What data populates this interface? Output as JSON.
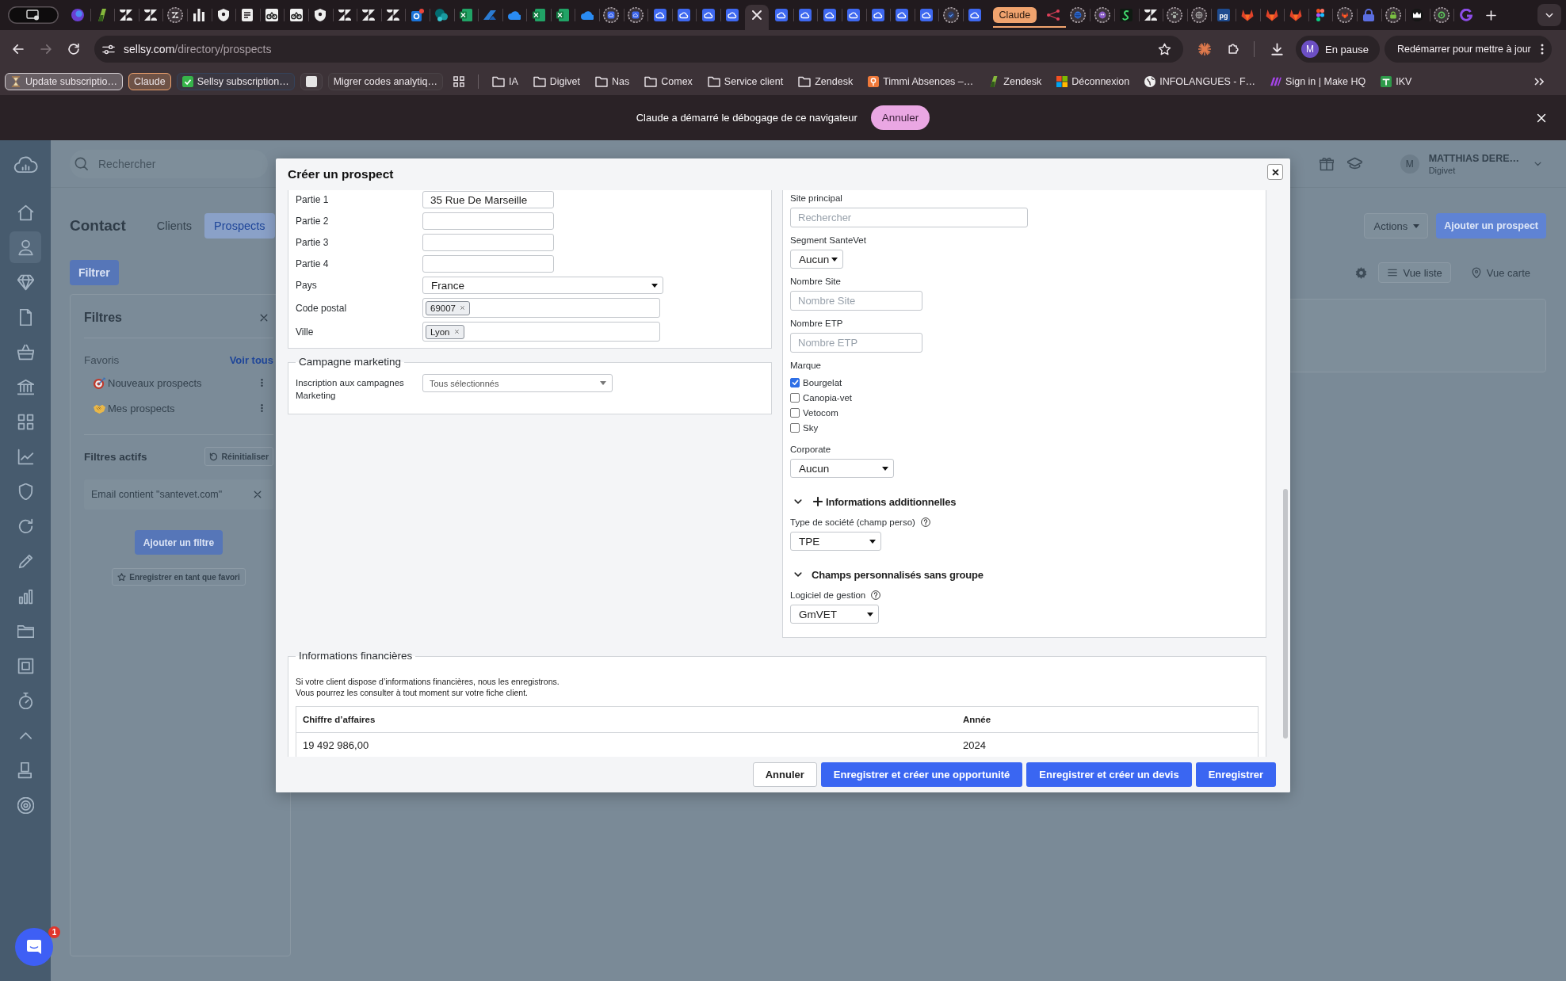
{
  "browser": {
    "tabs": [
      {
        "kind": "screen",
        "selected": false,
        "asleep": false
      },
      {
        "kind": "orb",
        "selected": false,
        "asleep": false
      },
      {
        "kind": "leaf",
        "selected": false,
        "asleep": false
      },
      {
        "kind": "z",
        "selected": false,
        "asleep": false
      },
      {
        "kind": "z",
        "selected": false,
        "asleep": false
      },
      {
        "kind": "z",
        "selected": false,
        "asleep": true
      },
      {
        "kind": "bars",
        "selected": false,
        "asleep": false
      },
      {
        "kind": "shield",
        "selected": false,
        "asleep": false
      },
      {
        "kind": "doc",
        "selected": false,
        "asleep": false
      },
      {
        "kind": "bikes",
        "selected": false,
        "asleep": false
      },
      {
        "kind": "bikes",
        "selected": false,
        "asleep": false
      },
      {
        "kind": "shield",
        "selected": false,
        "asleep": false
      },
      {
        "kind": "z",
        "selected": false,
        "asleep": false
      },
      {
        "kind": "z",
        "selected": false,
        "asleep": false
      },
      {
        "kind": "z",
        "selected": false,
        "asleep": false
      },
      {
        "kind": "mail",
        "selected": false,
        "asleep": false
      },
      {
        "kind": "share",
        "selected": false,
        "asleep": false
      },
      {
        "kind": "sheet",
        "selected": false,
        "asleep": false
      },
      {
        "kind": "arrow",
        "selected": false,
        "asleep": false
      },
      {
        "kind": "cloud",
        "selected": false,
        "asleep": false
      },
      {
        "kind": "sheet",
        "selected": false,
        "asleep": false
      },
      {
        "kind": "sheet",
        "selected": false,
        "asleep": false
      },
      {
        "kind": "cloud",
        "selected": false,
        "asleep": false
      },
      {
        "kind": "cloud-tile",
        "selected": false,
        "asleep": true
      },
      {
        "kind": "cloud-tile",
        "selected": false,
        "asleep": true
      },
      {
        "kind": "cloud-tile",
        "selected": false,
        "asleep": false
      },
      {
        "kind": "cloud-tile",
        "selected": false,
        "asleep": false
      },
      {
        "kind": "cloud-tile",
        "selected": false,
        "asleep": false
      },
      {
        "kind": "cloud-tile",
        "selected": false,
        "asleep": false
      },
      {
        "selected": true,
        "asleep": false
      },
      {
        "kind": "cloud-tile",
        "selected": false,
        "asleep": false
      },
      {
        "kind": "cloud-tile",
        "selected": false,
        "asleep": false
      },
      {
        "kind": "cloud-tile",
        "selected": false,
        "asleep": false
      },
      {
        "kind": "cloud-tile",
        "selected": false,
        "asleep": false
      },
      {
        "kind": "cloud-tile",
        "selected": false,
        "asleep": false
      },
      {
        "kind": "cloud-tile",
        "selected": false,
        "asleep": false
      },
      {
        "kind": "cloud-tile",
        "selected": false,
        "asleep": false
      },
      {
        "kind": "check",
        "selected": false,
        "asleep": true
      },
      {
        "kind": "cloud-tile",
        "selected": false,
        "asleep": false
      }
    ],
    "tab_group": {
      "label": "Claude",
      "tabs": [
        {
          "kind": "network",
          "selected": false,
          "asleep": false
        }
      ]
    },
    "more_tabs": [
      {
        "kind": "spiral",
        "selected": false,
        "asleep": true
      },
      {
        "kind": "mascot",
        "selected": false,
        "asleep": true
      },
      {
        "kind": "snake",
        "selected": false,
        "asleep": false
      },
      {
        "kind": "z",
        "selected": false,
        "asleep": false
      },
      {
        "kind": "paw",
        "selected": false,
        "asleep": true
      },
      {
        "kind": "globe",
        "selected": false,
        "asleep": true
      },
      {
        "kind": "tile",
        "text": "pg",
        "selected": false,
        "asleep": false
      },
      {
        "kind": "fox",
        "selected": false,
        "asleep": false
      },
      {
        "kind": "fox",
        "selected": false,
        "asleep": false
      },
      {
        "kind": "fox",
        "selected": false,
        "asleep": false
      },
      {
        "kind": "figma",
        "selected": false,
        "asleep": false
      },
      {
        "kind": "fox",
        "selected": false,
        "asleep": true
      },
      {
        "kind": "lock",
        "selected": false,
        "asleep": false
      },
      {
        "kind": "padlock",
        "selected": false,
        "asleep": true
      },
      {
        "kind": "crown",
        "selected": false,
        "asleep": false
      },
      {
        "kind": "ring",
        "selected": false,
        "asleep": true
      },
      {
        "kind": "g",
        "selected": false,
        "asleep": false
      }
    ],
    "nav_buttons": [
      {
        "kind": "back",
        "disabled": false
      },
      {
        "kind": "forward",
        "disabled": true
      },
      {
        "kind": "reload",
        "disabled": false
      }
    ],
    "address": {
      "host": "sellsy.com",
      "path": "/directory/prospects"
    },
    "profile": {
      "initial": "M",
      "status": "En pause"
    },
    "update_button": "Redémarrer pour mettre à jour",
    "bookmarks": [
      {
        "kind": "hourglass",
        "label": "Update subscriptio…",
        "group": true,
        "color": "#d6d0d4"
      },
      {
        "kind": "plain",
        "label": "Claude",
        "group": true,
        "color": "#f0a36e"
      },
      {
        "kind": "check",
        "label": "Sellsy subscription…",
        "group": true,
        "color": "#34435c"
      },
      {
        "kind": "square",
        "group": true,
        "color": "#4d464b"
      },
      {
        "kind": "plain",
        "label": "Migrer codes analytiq…",
        "group": true,
        "color": "#4a4347"
      },
      {
        "kind": "apps",
        "group": false
      },
      {
        "kind": "folder",
        "label": "IA",
        "group": false
      },
      {
        "kind": "folder",
        "label": "Digivet",
        "group": false
      },
      {
        "kind": "folder",
        "label": "Nas",
        "group": false
      },
      {
        "kind": "folder",
        "label": "Comex",
        "group": false
      },
      {
        "kind": "folder",
        "label": "Service client",
        "group": false
      },
      {
        "kind": "folder",
        "label": "Zendesk",
        "group": false
      },
      {
        "kind": "pin",
        "label": "Timmi Absences –…",
        "group": false
      },
      {
        "kind": "leaf",
        "label": "Zendesk",
        "group": false
      },
      {
        "kind": "tiles",
        "label": "Déconnexion",
        "group": false
      },
      {
        "kind": "globe",
        "label": "INFOLANGUES - F…",
        "group": false
      },
      {
        "kind": "wave",
        "label": "Sign in | Make HQ",
        "group": false
      },
      {
        "kind": "cross",
        "label": "IKV",
        "group": false
      }
    ],
    "infobar": {
      "message": "Claude a démarré le débogage de ce navigateur",
      "button": "Annuler"
    }
  },
  "app": {
    "nav": [
      {
        "kind": "home",
        "selected": false
      },
      {
        "kind": "person",
        "selected": true
      },
      {
        "kind": "gem",
        "selected": false
      },
      {
        "kind": "doc",
        "selected": false
      },
      {
        "kind": "basket",
        "selected": false
      },
      {
        "kind": "bank",
        "selected": false
      },
      {
        "kind": "grid",
        "selected": false
      },
      {
        "kind": "chart",
        "selected": false
      },
      {
        "kind": "shield",
        "selected": false
      },
      {
        "kind": "refresh",
        "selected": false
      },
      {
        "kind": "pen",
        "selected": false
      },
      {
        "kind": "bars",
        "selected": false
      },
      {
        "kind": "folder",
        "selected": false
      },
      {
        "kind": "stamp",
        "selected": false
      },
      {
        "kind": "timer",
        "selected": false
      },
      {
        "kind": "collapse",
        "selected": false
      },
      {
        "kind": "desk",
        "selected": false
      },
      {
        "kind": "target",
        "selected": false
      }
    ],
    "search": {
      "placeholder": "Rechercher"
    },
    "user": {
      "initial": "M",
      "name": "MATTHIAS DERE…",
      "company": "Digivet"
    },
    "page": {
      "title": "Contact",
      "tabs": [
        {
          "label": "Clients",
          "selected": false
        },
        {
          "label": "Prospects",
          "selected": true
        }
      ],
      "actions_button": "Actions",
      "add_button": "Ajouter un prospect",
      "filter_button": "Filtrer",
      "views": [
        {
          "kind": "list",
          "label": "Vue liste",
          "selected": true
        },
        {
          "kind": "map",
          "label": "Vue carte",
          "selected": false
        }
      ]
    },
    "filters": {
      "title": "Filtres",
      "favorites_label": "Favoris",
      "see_all": "Voir tous",
      "favorites": [
        {
          "kind": "target",
          "label": "Nouveaux prospects"
        },
        {
          "kind": "handshake",
          "label": "Mes prospects"
        }
      ],
      "active_label": "Filtres actifs",
      "reset_button": "Réinitialiser",
      "active": [
        {
          "label": "Email contient \"santevet.com\""
        }
      ],
      "add_button": "Ajouter un filtre",
      "save_button": "Enregistrer en tant que favori"
    },
    "chat": {
      "badge": "1"
    }
  },
  "modal": {
    "title": "Créer un prospect",
    "address_fields": [
      {
        "kind": "text",
        "label": "Partie 1",
        "value": "35 Rue De Marseille"
      },
      {
        "kind": "text",
        "label": "Partie 2"
      },
      {
        "kind": "text",
        "label": "Partie 3"
      },
      {
        "kind": "text",
        "label": "Partie 4"
      },
      {
        "kind": "select",
        "label": "Pays",
        "value": "France"
      },
      {
        "kind": "tags",
        "label": "Code postal",
        "tags": [
          "69007"
        ]
      },
      {
        "kind": "tags",
        "label": "Ville",
        "tags": [
          "Lyon"
        ]
      }
    ],
    "marketing": {
      "legend": "Campagne marketing",
      "label": "Inscription aux campagnes Marketing",
      "value": "Tous sélectionnés"
    },
    "company_fields": [
      {
        "kind": "search",
        "label": "Site principal",
        "placeholder": "Rechercher"
      },
      {
        "kind": "select",
        "label": "Segment SanteVet",
        "value": "Aucun"
      },
      {
        "kind": "number",
        "label": "Nombre Site",
        "placeholder": "Nombre Site"
      },
      {
        "kind": "number",
        "label": "Nombre ETP",
        "placeholder": "Nombre ETP"
      },
      {
        "kind": "checkboxes",
        "label": "Marque",
        "options": [
          {
            "label": "Bourgelat",
            "checked": true
          },
          {
            "label": "Canopia-vet",
            "checked": false
          },
          {
            "label": "Vetocom",
            "checked": false
          },
          {
            "label": "Sky",
            "checked": false
          }
        ]
      },
      {
        "kind": "select",
        "label": "Corporate",
        "value": "Aucun"
      }
    ],
    "sections": [
      {
        "kind": "plus",
        "title": "Informations additionnelles",
        "expanded": true,
        "fields": [
          {
            "kind": "select",
            "label": "Type de société (champ perso)",
            "help": true,
            "value": "TPE"
          }
        ]
      },
      {
        "kind": "plain",
        "title": "Champs personnalisés sans groupe",
        "expanded": true,
        "fields": [
          {
            "kind": "select",
            "label": "Logiciel de gestion",
            "help": true,
            "value": "GmVET"
          }
        ]
      }
    ],
    "finance": {
      "legend": "Informations financières",
      "intro": [
        "Si votre client dispose d’informations financières, nous les enregistrons.",
        "Vous pourrez les consulter à tout moment sur votre fiche client."
      ],
      "table": {
        "columns": [
          "Chiffre d’affaires",
          "Année"
        ],
        "rows": [
          [
            "19 492 986,00",
            "2024"
          ]
        ]
      }
    },
    "buttons": [
      {
        "kind": "secondary",
        "label": "Annuler"
      },
      {
        "kind": "primary",
        "label": "Enregistrer et créer une opportunité"
      },
      {
        "kind": "primary",
        "label": "Enregistrer et créer un devis"
      },
      {
        "kind": "primary",
        "label": "Enregistrer"
      }
    ]
  }
}
